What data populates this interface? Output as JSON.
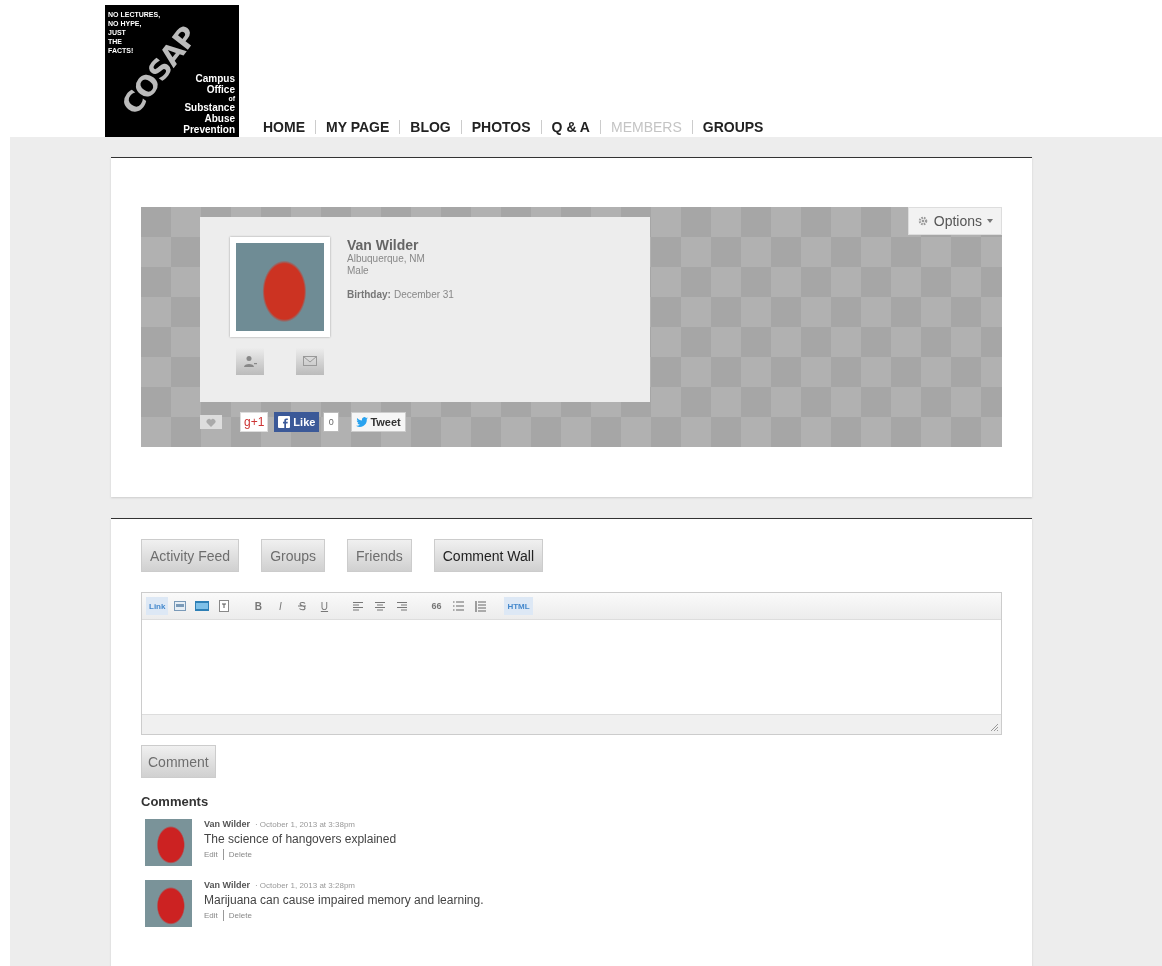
{
  "logo": {
    "tagline": [
      "NO LECTURES,",
      "NO HYPE,",
      "JUST",
      "THE",
      "FACTS!"
    ],
    "wordmark": "COSAP",
    "org_lines": [
      "Campus",
      "Office",
      "of",
      "Substance",
      "Abuse",
      "Prevention"
    ]
  },
  "nav": [
    {
      "label": "HOME",
      "selected": false
    },
    {
      "label": "MY PAGE",
      "selected": false
    },
    {
      "label": "BLOG",
      "selected": false
    },
    {
      "label": "PHOTOS",
      "selected": false
    },
    {
      "label": "Q & A",
      "selected": false
    },
    {
      "label": "MEMBERS",
      "selected": true
    },
    {
      "label": "GROUPS",
      "selected": false
    }
  ],
  "profile": {
    "name": "Van Wilder",
    "location": "Albuquerque, NM",
    "gender": "Male",
    "birthday_label": "Birthday:",
    "birthday": "December 31",
    "options": "Options"
  },
  "share": {
    "gplus": "g+1",
    "like": "Like",
    "like_count": "0",
    "tweet": "Tweet"
  },
  "tabs": [
    {
      "label": "Activity Feed",
      "selected": false
    },
    {
      "label": "Groups",
      "selected": false
    },
    {
      "label": "Friends",
      "selected": false
    },
    {
      "label": "Comment Wall",
      "selected": true
    }
  ],
  "toolbar": {
    "link": "Link",
    "bold": "B",
    "italic": "I",
    "underline": "U",
    "quote": "66",
    "html": "HTML"
  },
  "comment_button": "Comment",
  "comments_heading": "Comments",
  "comments": [
    {
      "author": "Van Wilder",
      "time": "· October 1, 2013 at 3:38pm",
      "text": "The science of hangovers explained",
      "edit": "Edit",
      "delete": "Delete"
    },
    {
      "author": "Van Wilder",
      "time": "· October 1, 2013 at 3:28pm",
      "text": "Marijuana can cause impaired memory and learning.",
      "edit": "Edit",
      "delete": "Delete"
    }
  ]
}
